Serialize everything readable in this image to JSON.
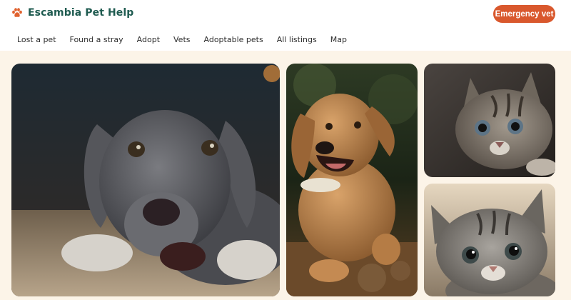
{
  "brand": {
    "name": "Escambia Pet Help",
    "icon": "paw-icon",
    "color": "#1f5b50"
  },
  "header": {
    "cta_label": "Emergency vet",
    "cta_color": "#d9582d"
  },
  "nav": {
    "items": [
      "Lost a pet",
      "Found a stray",
      "Adopt",
      "Vets",
      "Adoptable pets",
      "All listings",
      "Map"
    ]
  },
  "gallery": {
    "background": "#fcf4e8",
    "photos": [
      {
        "subject": "gray puppy lying on carpet"
      },
      {
        "subject": "golden dog running"
      },
      {
        "subject": "tabby kitten lying down"
      },
      {
        "subject": "tabby kitten looking up"
      }
    ]
  }
}
